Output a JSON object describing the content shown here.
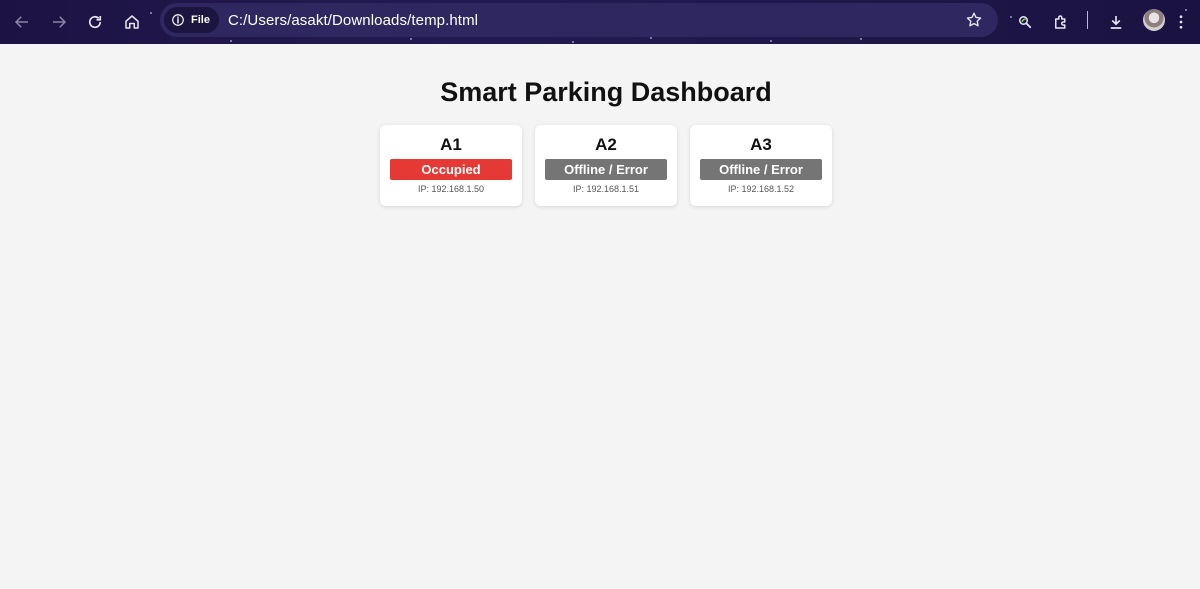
{
  "browser": {
    "site_chip_label": "File",
    "url": "C:/Users/asakt/Downloads/temp.html",
    "icons": [
      "back-arrow-icon",
      "forward-arrow-icon",
      "reload-icon",
      "home-icon",
      "info-icon",
      "star-outline-icon",
      "extension-leaf-icon",
      "puzzle-icon",
      "download-icon",
      "profile-avatar"
    ]
  },
  "page": {
    "title": "Smart Parking Dashboard"
  },
  "slots": [
    {
      "name": "A1",
      "status": "Occupied",
      "ip": "IP: 192.168.1.50",
      "status_color": "#e53935"
    },
    {
      "name": "A2",
      "status": "Offline / Error",
      "ip": "IP: 192.168.1.51",
      "status_color": "#757575"
    },
    {
      "name": "A3",
      "status": "Offline / Error",
      "ip": "IP: 192.168.1.52",
      "status_color": "#757575"
    }
  ],
  "colors": {
    "toolbar_bg": "#1d1342",
    "page_bg": "#f4f4f4",
    "occupied": "#e53935",
    "offline": "#757575"
  }
}
